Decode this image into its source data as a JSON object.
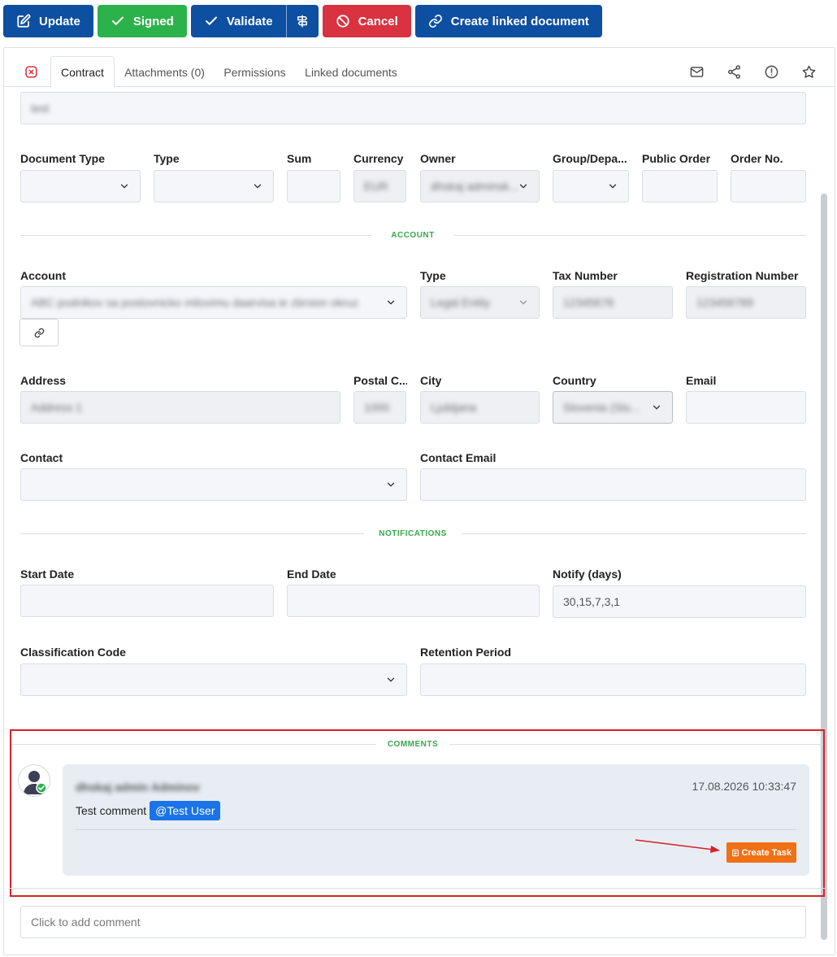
{
  "toolbar": {
    "update": "Update",
    "signed": "Signed",
    "validate": "Validate",
    "cancel": "Cancel",
    "create_linked": "Create linked document"
  },
  "tabs": {
    "contract": "Contract",
    "attachments": "Attachments (0)",
    "permissions": "Permissions",
    "linked": "Linked documents"
  },
  "fields": {
    "subject_value": "test",
    "document_type": {
      "label": "Document Type",
      "value": ""
    },
    "type": {
      "label": "Type",
      "value": ""
    },
    "sum": {
      "label": "Sum",
      "value": ""
    },
    "currency": {
      "label": "Currency",
      "value": "EUR"
    },
    "owner": {
      "label": "Owner",
      "value": "dhskaj adminsk..."
    },
    "group": {
      "label": "Group/Depa...",
      "value": ""
    },
    "public_order": {
      "label": "Public Order",
      "value": ""
    },
    "order_no": {
      "label": "Order No.",
      "value": ""
    },
    "account": {
      "label": "Account",
      "value": "ABC podnikov sa postovnicko milovimu daarvisa ie zbrsion okruz"
    },
    "account_type": {
      "label": "Type",
      "value": "Legal Entity"
    },
    "tax_number": {
      "label": "Tax Number",
      "value": "12345678"
    },
    "registration_number": {
      "label": "Registration Number",
      "value": "123456789"
    },
    "address": {
      "label": "Address",
      "value": "Address 1"
    },
    "postal_code": {
      "label": "Postal C...",
      "value": "1000"
    },
    "city": {
      "label": "City",
      "value": "Ljubljana"
    },
    "country": {
      "label": "Country",
      "value": "Slovenia (Slo..."
    },
    "email": {
      "label": "Email",
      "value": ""
    },
    "contact": {
      "label": "Contact",
      "value": ""
    },
    "contact_email": {
      "label": "Contact Email",
      "value": ""
    },
    "start_date": {
      "label": "Start Date",
      "value": ""
    },
    "end_date": {
      "label": "End Date",
      "value": ""
    },
    "notify_days": {
      "label": "Notify (days)",
      "value": "30,15,7,3,1"
    },
    "classification_code": {
      "label": "Classification Code",
      "value": ""
    },
    "retention_period": {
      "label": "Retention Period",
      "value": ""
    }
  },
  "sections": {
    "account": "ACCOUNT",
    "notifications": "NOTIFICATIONS",
    "comments": "COMMENTS"
  },
  "comment": {
    "author": "dhskaj admin Adminov",
    "timestamp": "17.08.2026 10:33:47",
    "text": "Test comment",
    "mention": "@Test User",
    "create_task": "Create Task"
  },
  "add_comment_placeholder": "Click to add comment",
  "colors": {
    "primary": "#0d4fa1",
    "success": "#2cb24a",
    "danger": "#d8333f",
    "section": "#3aa64e",
    "task": "#f07014",
    "highlight": "#d8212a"
  }
}
